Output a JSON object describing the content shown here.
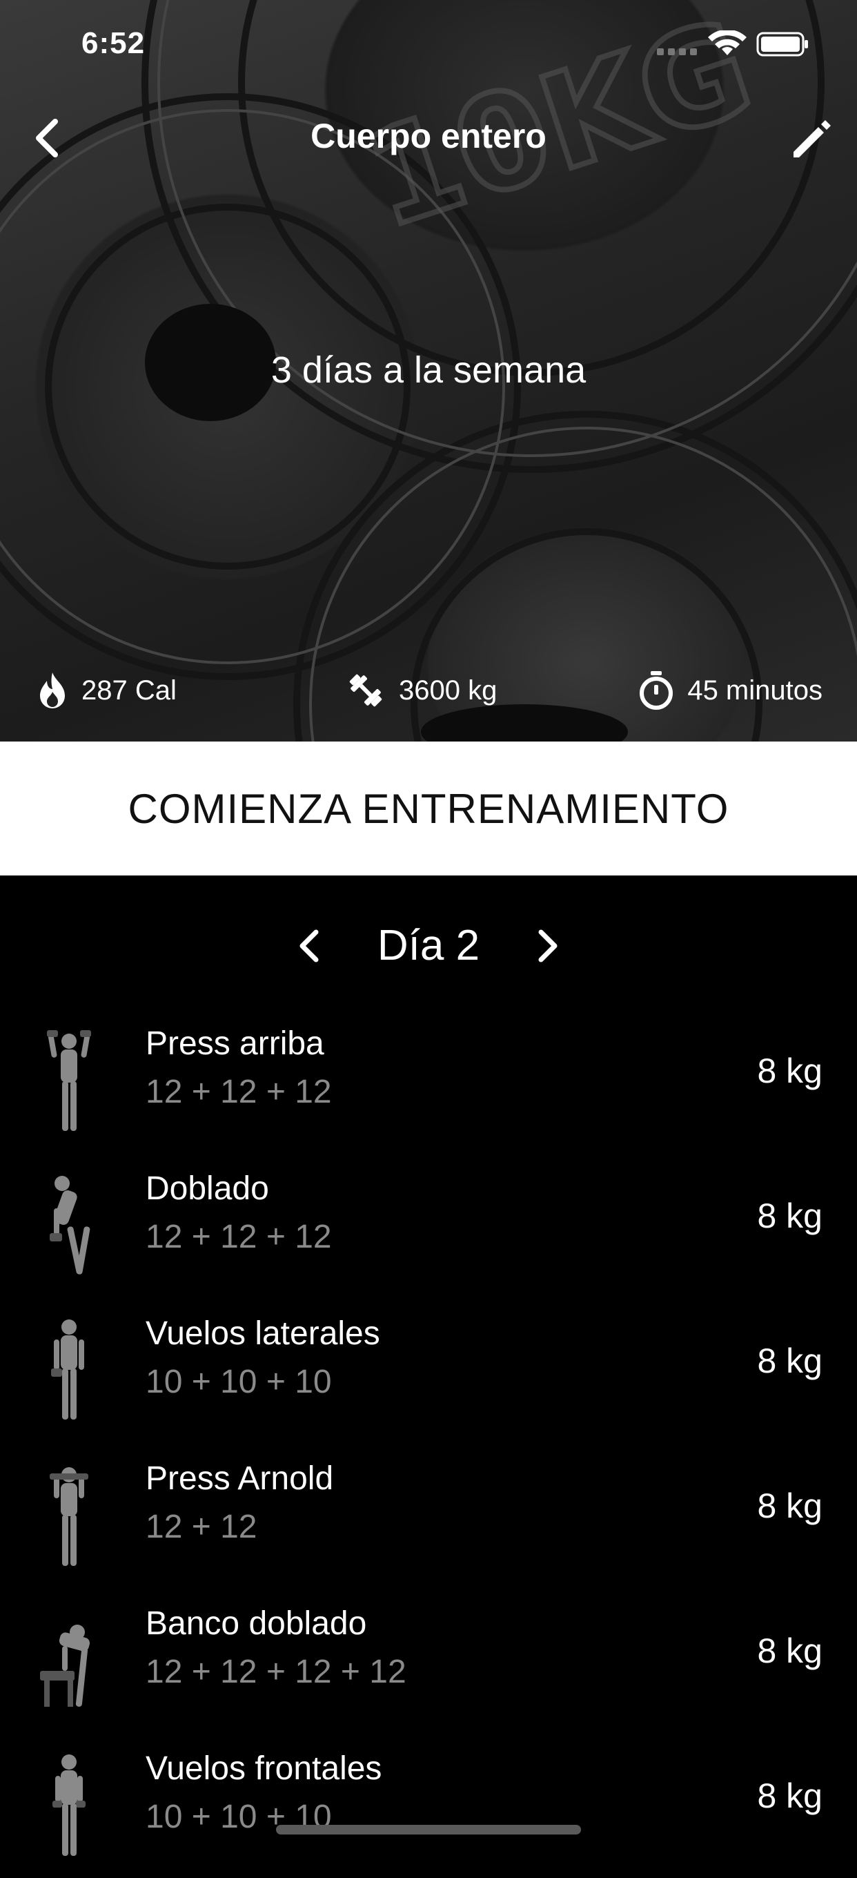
{
  "status_bar": {
    "time": "6:52"
  },
  "nav": {
    "title": "Cuerpo entero"
  },
  "hero": {
    "subtitle": "3 días a la semana",
    "stats": {
      "calories": "287 Cal",
      "weight": "3600 kg",
      "duration": "45 minutos"
    }
  },
  "start_button": {
    "label": "COMIENZA ENTRENAMIENTO"
  },
  "day_selector": {
    "label": "Día 2"
  },
  "exercises": [
    {
      "name": "Press arriba",
      "sets": "12 + 12 + 12",
      "weight": "8 kg"
    },
    {
      "name": "Doblado",
      "sets": "12 + 12 + 12",
      "weight": "8 kg"
    },
    {
      "name": "Vuelos laterales",
      "sets": "10 + 10 + 10",
      "weight": "8 kg"
    },
    {
      "name": "Press Arnold",
      "sets": "12 + 12",
      "weight": "8 kg"
    },
    {
      "name": "Banco doblado",
      "sets": "12 + 12 + 12 + 12",
      "weight": "8 kg"
    },
    {
      "name": "Vuelos frontales",
      "sets": "10 + 10 + 10",
      "weight": "8 kg"
    }
  ]
}
